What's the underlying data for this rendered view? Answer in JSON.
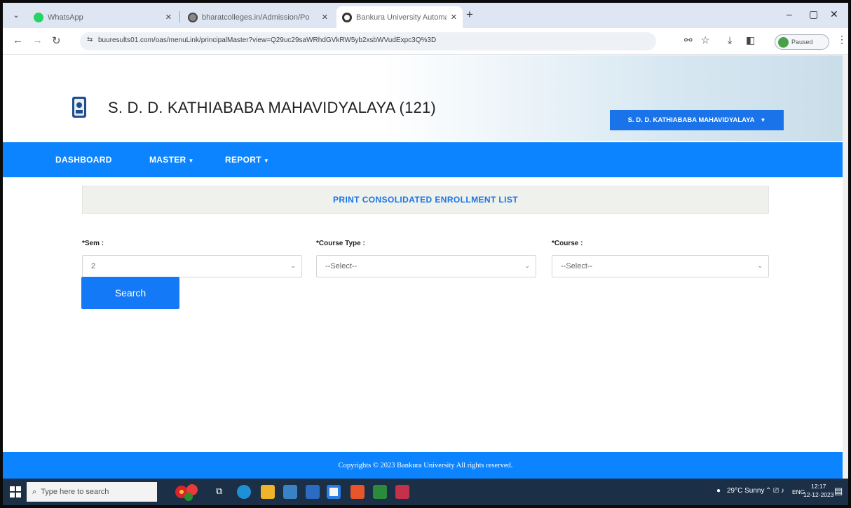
{
  "browser": {
    "tabs": [
      {
        "title": "WhatsApp",
        "favicon_color": "#25d366"
      },
      {
        "title": "bharatcolleges.in/Admission/Po",
        "favicon_color": "#666666"
      },
      {
        "title": "Bankura University Automation",
        "favicon_color": "#333333"
      }
    ],
    "url_site_icon": "⇆",
    "url": "buuresults01.com/oas/menuLink/principalMaster?view=Q29uc29saWRhdGVkRW5yb2xsbWVudExpc3Q%3D",
    "profile_label": "Paused",
    "window_controls": {
      "minimize": "–",
      "maximize": "▢",
      "close": "✕"
    }
  },
  "header": {
    "title": "S. D. D. KATHIABABA MAHAVIDYALAYA (121)",
    "institution_button": "S. D. D. KATHIABABA MAHAVIDYALAYA"
  },
  "nav": {
    "items": [
      {
        "label": "DASHBOARD",
        "has_caret": false
      },
      {
        "label": "MASTER",
        "has_caret": true
      },
      {
        "label": "REPORT",
        "has_caret": true
      }
    ]
  },
  "panel": {
    "title": "PRINT CONSOLIDATED ENROLLMENT LIST"
  },
  "form": {
    "sem": {
      "label": "*Sem :",
      "value": "2"
    },
    "course_type": {
      "label": "*Course Type :",
      "value": "--Select--"
    },
    "course": {
      "label": "*Course :",
      "value": "--Select--"
    },
    "search_label": "Search"
  },
  "footer": {
    "text": "Copyrights © 2023 Bankura University All rights reserved."
  },
  "taskbar": {
    "search_placeholder": "Type here to search",
    "weather": "29°C Sunny",
    "language": "ENG",
    "time": "12:17",
    "date": "12-12-2023"
  },
  "colors": {
    "accent": "#0c84ff",
    "button": "#1a73e8",
    "taskbar": "#1b2f46"
  }
}
